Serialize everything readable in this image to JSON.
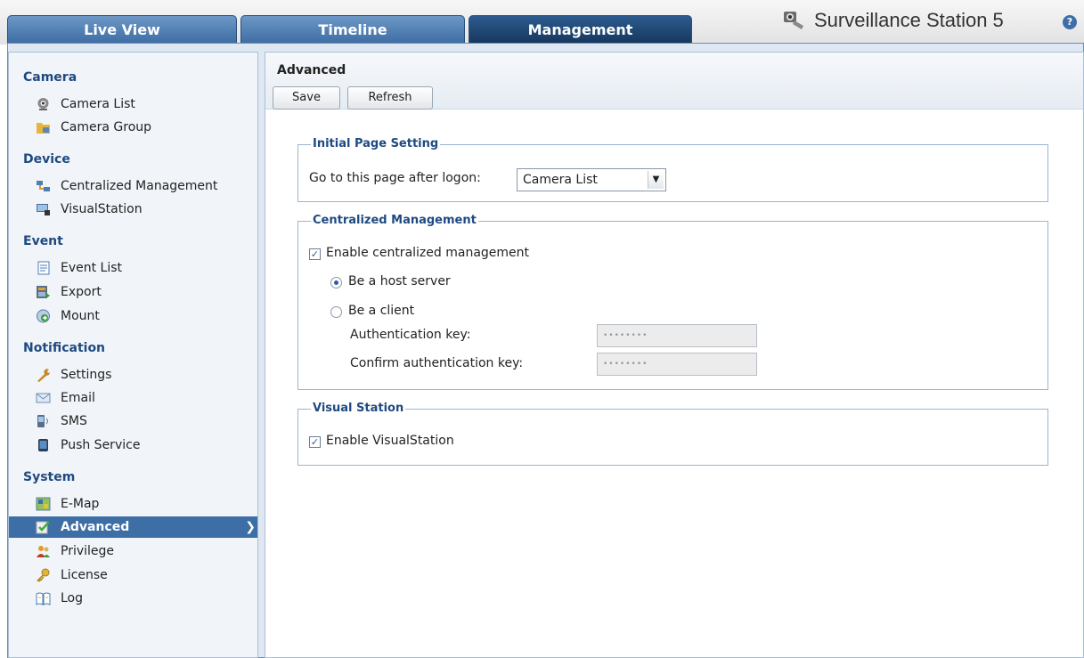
{
  "header": {
    "tabs": [
      {
        "label": "Live View",
        "active": false
      },
      {
        "label": "Timeline",
        "active": false
      },
      {
        "label": "Management",
        "active": true
      }
    ],
    "app_title": "Surveillance Station 5",
    "help_label": "?"
  },
  "sidebar": {
    "sections": [
      {
        "title": "Camera",
        "items": [
          {
            "label": "Camera List",
            "icon": "camera-icon"
          },
          {
            "label": "Camera Group",
            "icon": "folder-camera-icon"
          }
        ]
      },
      {
        "title": "Device",
        "items": [
          {
            "label": "Centralized Management",
            "icon": "network-icon"
          },
          {
            "label": "VisualStation",
            "icon": "monitor-icon"
          }
        ]
      },
      {
        "title": "Event",
        "items": [
          {
            "label": "Event List",
            "icon": "list-icon"
          },
          {
            "label": "Export",
            "icon": "export-icon"
          },
          {
            "label": "Mount",
            "icon": "mount-icon"
          }
        ]
      },
      {
        "title": "Notification",
        "items": [
          {
            "label": "Settings",
            "icon": "wrench-icon"
          },
          {
            "label": "Email",
            "icon": "envelope-icon"
          },
          {
            "label": "SMS",
            "icon": "sms-icon"
          },
          {
            "label": "Push Service",
            "icon": "phone-icon"
          }
        ]
      },
      {
        "title": "System",
        "items": [
          {
            "label": "E-Map",
            "icon": "map-icon"
          },
          {
            "label": "Advanced",
            "icon": "advanced-icon",
            "selected": true
          },
          {
            "label": "Privilege",
            "icon": "users-icon"
          },
          {
            "label": "License",
            "icon": "key-icon"
          },
          {
            "label": "Log",
            "icon": "book-icon"
          }
        ]
      }
    ]
  },
  "main": {
    "title": "Advanced",
    "save_label": "Save",
    "refresh_label": "Refresh",
    "initial_page": {
      "legend": "Initial Page Setting",
      "label": "Go to this page after logon:",
      "selected": "Camera List"
    },
    "central": {
      "legend": "Centralized Management",
      "enable_label": "Enable centralized management",
      "enable_checked": true,
      "host_label": "Be a host server",
      "host_selected": true,
      "client_label": "Be a client",
      "client_selected": false,
      "auth_label": "Authentication key:",
      "auth_value": "••••••••",
      "confirm_label": "Confirm authentication key:",
      "confirm_value": "••••••••"
    },
    "visual": {
      "legend": "Visual Station",
      "enable_label": "Enable VisualStation",
      "enable_checked": true
    }
  },
  "colors": {
    "accent": "#3d6ea6",
    "section_title": "#1f4a80",
    "tab_active": "#16385f"
  }
}
